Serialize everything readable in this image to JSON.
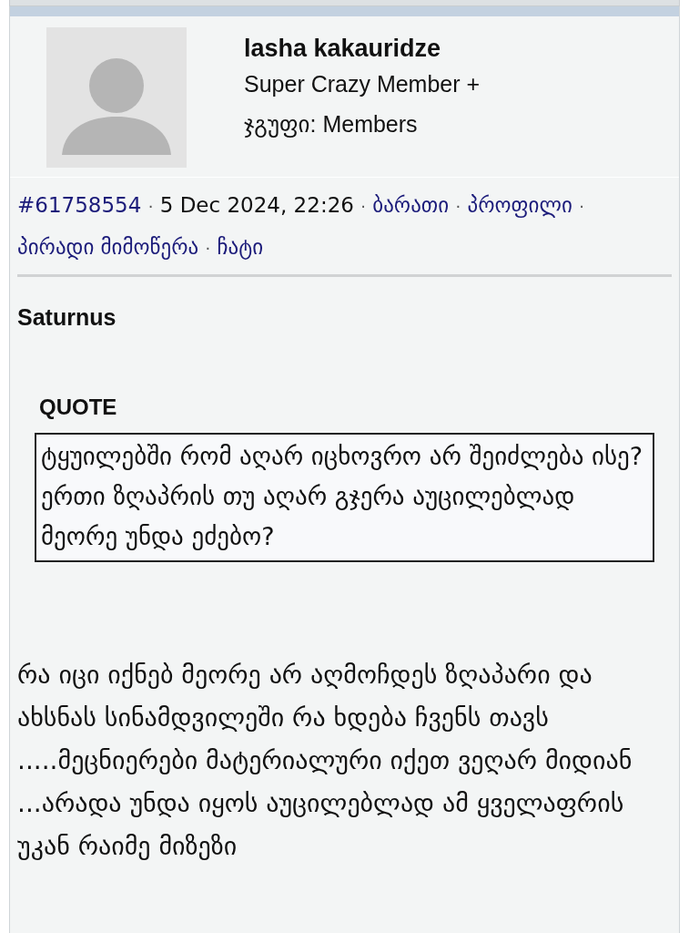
{
  "author": {
    "name": "lasha kakauridze",
    "rank": "Super Crazy Member +",
    "group_label": "ჯგუფი:",
    "group": "Members"
  },
  "meta": [
    {
      "kind": "link",
      "text": "#61758554"
    },
    {
      "kind": "separator",
      "text": "·"
    },
    {
      "kind": "text",
      "text": "5 Dec 2024, 22:26"
    },
    {
      "kind": "separator",
      "text": "·"
    },
    {
      "kind": "link",
      "text": "ბარათი"
    },
    {
      "kind": "separator",
      "text": "·"
    },
    {
      "kind": "link",
      "text": "პროფილი"
    },
    {
      "kind": "separator",
      "text": "·"
    },
    {
      "kind": "link",
      "text": "პირადი მიმოწერა"
    },
    {
      "kind": "separator",
      "text": "·"
    },
    {
      "kind": "link",
      "text": "ჩატი"
    }
  ],
  "post": {
    "quoted_author": "Saturnus",
    "quote_label": "QUOTE",
    "quote": "ტყუილებში რომ აღარ იცხოვრო არ შეიძლება ისე? ერთი ზღაპრის თუ აღარ გჯერა აუცილებლად მეორე უნდა ეძებო?",
    "body": "რა იცი იქნებ მეორე არ აღმოჩდეს ზღაპარი და ახსნას სინამდვილეში რა ხდება ჩვენს თავს .....მეცნიერები მატერიალური იქეთ ვეღარ მიდიან ...არადა უნდა იყოს აუცილებლად ამ ყველაფრის უკან რაიმე მიზეზი"
  }
}
